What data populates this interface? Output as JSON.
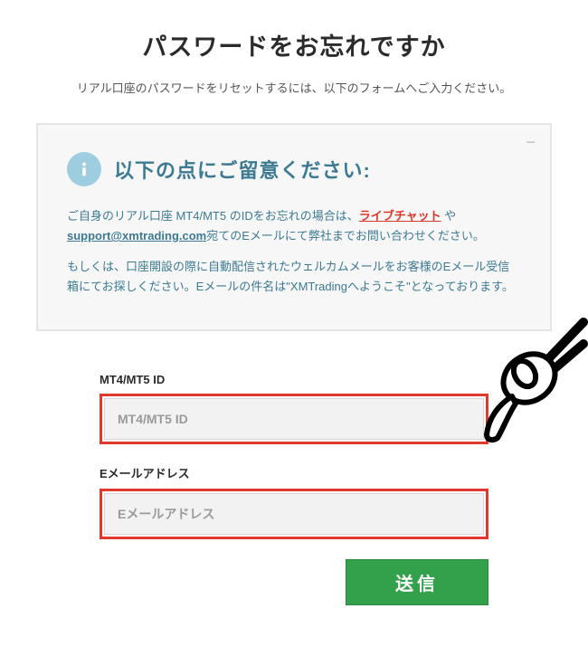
{
  "page": {
    "title": "パスワードをお忘れですか",
    "subtitle": "リアル口座のパスワードをリセットするには、以下のフォームへご入力ください。"
  },
  "notice": {
    "title": "以下の点にご留意ください:",
    "collapse_glyph": "−",
    "p1_a": "ご自身のリアル口座 MT4/MT5 のIDをお忘れの場合は、",
    "p1_link1": "ライブチャット",
    "p1_b": " や ",
    "p1_link2": "support@xmtrading.com",
    "p1_c": "宛てのEメールにて弊社までお問い合わせください。",
    "p2": "もしくは、口座開設の際に自動配信されたウェルカムメールをお客様のEメール受信箱にてお探しください。Eメールの件名は\"XMTradingへようこそ\"となっております。"
  },
  "form": {
    "id_label": "MT4/MT5 ID",
    "id_placeholder": "MT4/MT5 ID",
    "email_label": "Eメールアドレス",
    "email_placeholder": "Eメールアドレス",
    "submit_label": "送信"
  }
}
